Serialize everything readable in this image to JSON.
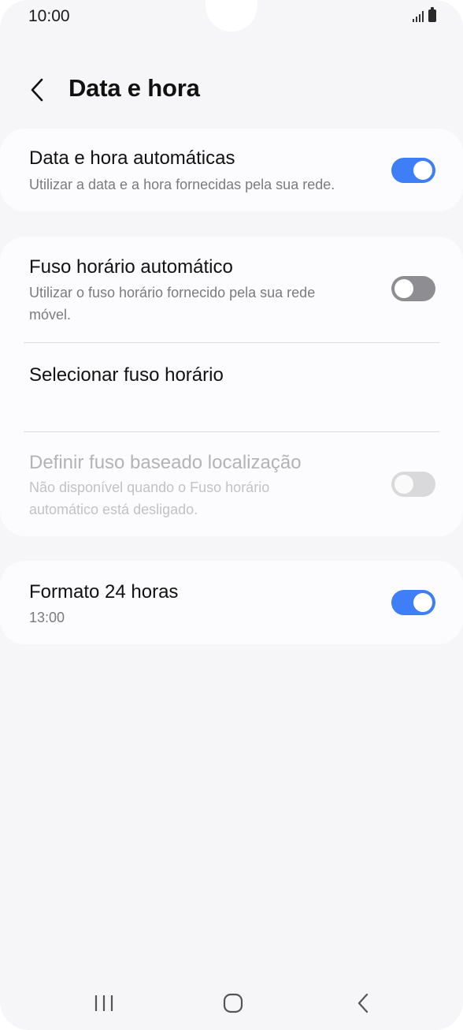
{
  "status_bar": {
    "time": "10:00"
  },
  "header": {
    "title": "Data e hora",
    "back_icon": "chevron-left-icon"
  },
  "settings": {
    "auto_datetime": {
      "title": "Data e hora automáticas",
      "subtitle": "Utilizar a data e a hora fornecidas pela sua rede.",
      "enabled": true
    },
    "auto_timezone": {
      "title": "Fuso horário automático",
      "subtitle_line1": "Utilizar o fuso horário fornecido pela sua rede",
      "subtitle_line2": "móvel.",
      "enabled": false
    },
    "select_timezone": {
      "title": "Selecionar fuso horário"
    },
    "location_timezone": {
      "title": "Definir fuso baseado localização",
      "subtitle_line1": "Não disponível quando o Fuso horário",
      "subtitle_line2": "automático está desligado.",
      "enabled": false,
      "available": false
    },
    "format_24h": {
      "title": "Formato 24 horas",
      "subtitle": "13:00",
      "enabled": true
    }
  },
  "colors": {
    "accent": "#3e7ef7",
    "background": "#f6f6f8",
    "card": "#fcfcfe"
  },
  "nav_bar": {
    "icons": [
      "recent-apps-icon",
      "home-icon",
      "back-icon"
    ]
  }
}
